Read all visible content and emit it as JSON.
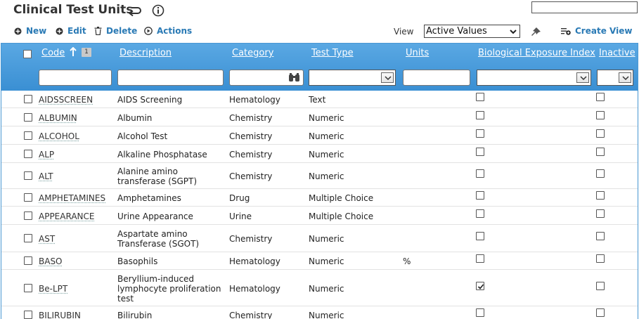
{
  "header": {
    "title": "Clinical Test Units",
    "search_value": ""
  },
  "toolbar": {
    "new_label": "New",
    "edit_label": "Edit",
    "delete_label": "Delete",
    "actions_label": "Actions",
    "view_label": "View",
    "view_selected": "Active Values",
    "create_view_label": "Create View",
    "accent": "#2a7ab5"
  },
  "grid": {
    "header_color": "#3a8fd3",
    "columns": {
      "code": "Code",
      "description": "Description",
      "category": "Category",
      "test_type": "Test Type",
      "units": "Units",
      "bei": "Biological Exposure Index",
      "inactive": "Inactive"
    },
    "sort_badge": "1",
    "rows": [
      {
        "code": "AIDSSCREEN",
        "description": "AIDS Screening",
        "category": "Hematology",
        "test_type": "Text",
        "units": "",
        "bei": false,
        "inactive": false
      },
      {
        "code": "ALBUMIN",
        "description": "Albumin",
        "category": "Chemistry",
        "test_type": "Numeric",
        "units": "",
        "bei": false,
        "inactive": false
      },
      {
        "code": "ALCOHOL",
        "description": "Alcohol Test",
        "category": "Chemistry",
        "test_type": "Numeric",
        "units": "",
        "bei": false,
        "inactive": false
      },
      {
        "code": "ALP",
        "description": "Alkaline Phosphatase",
        "category": "Chemistry",
        "test_type": "Numeric",
        "units": "",
        "bei": false,
        "inactive": false
      },
      {
        "code": "ALT",
        "description": "Alanine amino transferase (SGPT)",
        "category": "Chemistry",
        "test_type": "Numeric",
        "units": "",
        "bei": false,
        "inactive": false
      },
      {
        "code": "AMPHETAMINES",
        "description": "Amphetamines",
        "category": "Drug",
        "test_type": "Multiple Choice",
        "units": "",
        "bei": false,
        "inactive": false
      },
      {
        "code": "APPEARANCE",
        "description": "Urine Appearance",
        "category": "Urine",
        "test_type": "Multiple Choice",
        "units": "",
        "bei": false,
        "inactive": false
      },
      {
        "code": "AST",
        "description": "Aspartate amino Transferase (SGOT)",
        "category": "Chemistry",
        "test_type": "Numeric",
        "units": "",
        "bei": false,
        "inactive": false
      },
      {
        "code": "BASO",
        "description": "Basophils",
        "category": "Hematology",
        "test_type": "Numeric",
        "units": "%",
        "bei": false,
        "inactive": false
      },
      {
        "code": "Be-LPT",
        "description": "Beryllium-induced lymphocyte proliferation test",
        "category": "Hematology",
        "test_type": "Numeric",
        "units": "",
        "bei": true,
        "inactive": false
      },
      {
        "code": "BILIRUBIN",
        "description": "Bilirubin",
        "category": "Chemistry",
        "test_type": "Numeric",
        "units": "",
        "bei": false,
        "inactive": false
      }
    ]
  }
}
